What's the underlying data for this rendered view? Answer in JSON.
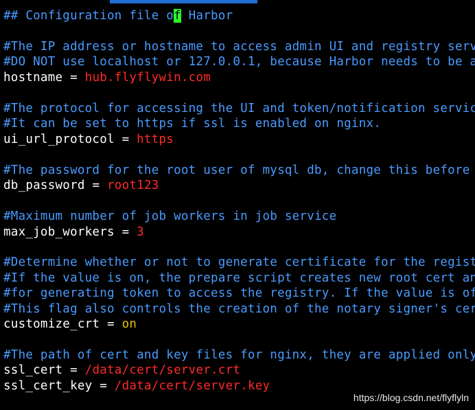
{
  "colors": {
    "background": "#000000",
    "comment": "#4a9bff",
    "key": "#ffffff",
    "string_value": "#ff2a2a",
    "boolean_value": "#e6c300",
    "cursor": "#2bff2b"
  },
  "lines": {
    "heading": {
      "before": "## Configuration file o",
      "cursor_char": "f",
      "after": " Harbor"
    },
    "c1": "#The IP address or hostname to access admin UI and registry serv",
    "c2": "#DO NOT use localhost or 127.0.0.1, because Harbor needs to be a",
    "hostname": {
      "key": "hostname",
      "eq": " = ",
      "value": "hub.flyflywin.com"
    },
    "c3": "#The protocol for accessing the UI and token/notification servic",
    "c4": "#It can be set to https if ssl is enabled on nginx.",
    "ui_url_protocol": {
      "key": "ui_url_protocol",
      "eq": " = ",
      "value": "https"
    },
    "c5": "#The password for the root user of mysql db, change this before",
    "db_password": {
      "key": "db_password",
      "eq": " = ",
      "value": "root123"
    },
    "c6": "#Maximum number of job workers in job service",
    "max_job_workers": {
      "key": "max_job_workers",
      "eq": " = ",
      "value": "3"
    },
    "c7": "#Determine whether or not to generate certificate for the regist",
    "c8": "#If the value is on, the prepare script creates new root cert an",
    "c9": "#for generating token to access the registry. If the value is of",
    "c10": "#This flag also controls the creation of the notary signer's cer",
    "customize_crt": {
      "key": "customize_crt",
      "eq": " = ",
      "value": "on"
    },
    "c11": "#The path of cert and key files for nginx, they are applied only",
    "ssl_cert": {
      "key": "ssl_cert",
      "eq": " = ",
      "value": "/data/cert/server.crt"
    },
    "ssl_cert_key": {
      "key": "ssl_cert_key",
      "eq": " = ",
      "value": "/data/cert/server.key"
    }
  },
  "watermark": "https://blog.csdn.net/flyflyln"
}
